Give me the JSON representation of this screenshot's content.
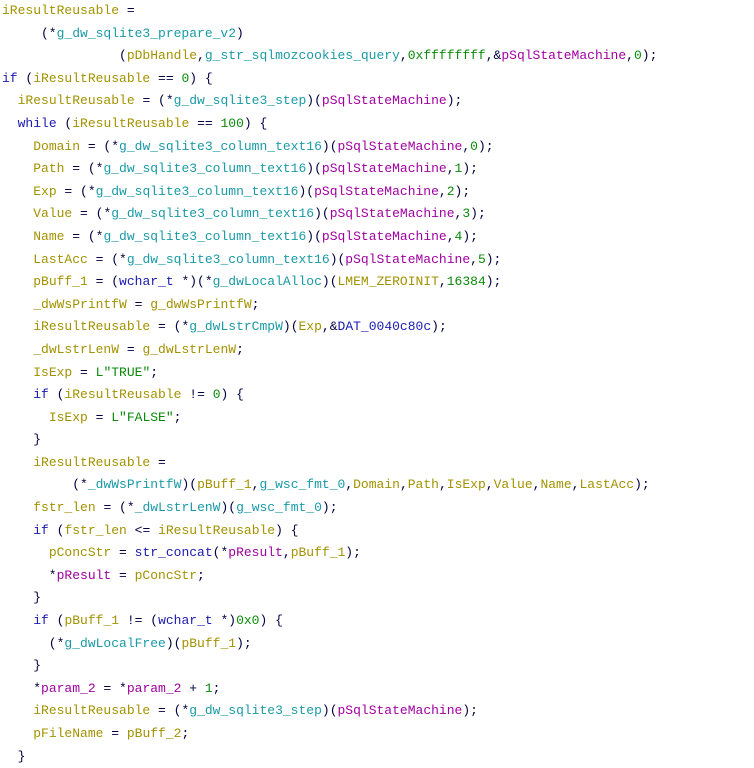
{
  "editor": {
    "kind": "decompiler-listing",
    "colors": {
      "keyword": "#1a1ab0",
      "local_variable": "#a39200",
      "global": "#1a9aa6",
      "parameter": "#a000a0",
      "number": "#0a8a0a",
      "string": "#0a8a0a",
      "punctuation": "#000040",
      "background": "#ffffff"
    },
    "lines": [
      [
        {
          "t": "lv",
          "s": "iResultReusable"
        },
        {
          "t": "op",
          "s": " ="
        }
      ],
      [
        {
          "t": "op",
          "s": "     (*"
        },
        {
          "t": "gl",
          "s": "g_dw_sqlite3_prepare_v2"
        },
        {
          "t": "op",
          "s": ")"
        }
      ],
      [
        {
          "t": "op",
          "s": "               ("
        },
        {
          "t": "lv",
          "s": "pDbHandle"
        },
        {
          "t": "op",
          "s": ","
        },
        {
          "t": "gl",
          "s": "g_str_sqlmozcookies_query"
        },
        {
          "t": "op",
          "s": ","
        },
        {
          "t": "nu",
          "s": "0xffffffff"
        },
        {
          "t": "op",
          "s": ",&"
        },
        {
          "t": "pa",
          "s": "pSqlStateMachine"
        },
        {
          "t": "op",
          "s": ","
        },
        {
          "t": "nu",
          "s": "0"
        },
        {
          "t": "op",
          "s": ");"
        }
      ],
      [
        {
          "t": "kw",
          "s": "if"
        },
        {
          "t": "op",
          "s": " ("
        },
        {
          "t": "lv",
          "s": "iResultReusable"
        },
        {
          "t": "op",
          "s": " == "
        },
        {
          "t": "nu",
          "s": "0"
        },
        {
          "t": "op",
          "s": ") {"
        }
      ],
      [
        {
          "t": "op",
          "s": "  "
        },
        {
          "t": "lv",
          "s": "iResultReusable"
        },
        {
          "t": "op",
          "s": " = (*"
        },
        {
          "t": "gl",
          "s": "g_dw_sqlite3_step"
        },
        {
          "t": "op",
          "s": ")("
        },
        {
          "t": "pa",
          "s": "pSqlStateMachine"
        },
        {
          "t": "op",
          "s": ");"
        }
      ],
      [
        {
          "t": "op",
          "s": "  "
        },
        {
          "t": "kw",
          "s": "while"
        },
        {
          "t": "op",
          "s": " ("
        },
        {
          "t": "lv",
          "s": "iResultReusable"
        },
        {
          "t": "op",
          "s": " == "
        },
        {
          "t": "nu",
          "s": "100"
        },
        {
          "t": "op",
          "s": ") {"
        }
      ],
      [
        {
          "t": "op",
          "s": "    "
        },
        {
          "t": "lv",
          "s": "Domain"
        },
        {
          "t": "op",
          "s": " = (*"
        },
        {
          "t": "gl",
          "s": "g_dw_sqlite3_column_text16"
        },
        {
          "t": "op",
          "s": ")("
        },
        {
          "t": "pa",
          "s": "pSqlStateMachine"
        },
        {
          "t": "op",
          "s": ","
        },
        {
          "t": "nu",
          "s": "0"
        },
        {
          "t": "op",
          "s": ");"
        }
      ],
      [
        {
          "t": "op",
          "s": "    "
        },
        {
          "t": "lv",
          "s": "Path"
        },
        {
          "t": "op",
          "s": " = (*"
        },
        {
          "t": "gl",
          "s": "g_dw_sqlite3_column_text16"
        },
        {
          "t": "op",
          "s": ")("
        },
        {
          "t": "pa",
          "s": "pSqlStateMachine"
        },
        {
          "t": "op",
          "s": ","
        },
        {
          "t": "nu",
          "s": "1"
        },
        {
          "t": "op",
          "s": ");"
        }
      ],
      [
        {
          "t": "op",
          "s": "    "
        },
        {
          "t": "lv",
          "s": "Exp"
        },
        {
          "t": "op",
          "s": " = (*"
        },
        {
          "t": "gl",
          "s": "g_dw_sqlite3_column_text16"
        },
        {
          "t": "op",
          "s": ")("
        },
        {
          "t": "pa",
          "s": "pSqlStateMachine"
        },
        {
          "t": "op",
          "s": ","
        },
        {
          "t": "nu",
          "s": "2"
        },
        {
          "t": "op",
          "s": ");"
        }
      ],
      [
        {
          "t": "op",
          "s": "    "
        },
        {
          "t": "lv",
          "s": "Value"
        },
        {
          "t": "op",
          "s": " = (*"
        },
        {
          "t": "gl",
          "s": "g_dw_sqlite3_column_text16"
        },
        {
          "t": "op",
          "s": ")("
        },
        {
          "t": "pa",
          "s": "pSqlStateMachine"
        },
        {
          "t": "op",
          "s": ","
        },
        {
          "t": "nu",
          "s": "3"
        },
        {
          "t": "op",
          "s": ");"
        }
      ],
      [
        {
          "t": "op",
          "s": "    "
        },
        {
          "t": "lv",
          "s": "Name"
        },
        {
          "t": "op",
          "s": " = (*"
        },
        {
          "t": "gl",
          "s": "g_dw_sqlite3_column_text16"
        },
        {
          "t": "op",
          "s": ")("
        },
        {
          "t": "pa",
          "s": "pSqlStateMachine"
        },
        {
          "t": "op",
          "s": ","
        },
        {
          "t": "nu",
          "s": "4"
        },
        {
          "t": "op",
          "s": ");"
        }
      ],
      [
        {
          "t": "op",
          "s": "    "
        },
        {
          "t": "lv",
          "s": "LastAcc"
        },
        {
          "t": "op",
          "s": " = (*"
        },
        {
          "t": "gl",
          "s": "g_dw_sqlite3_column_text16"
        },
        {
          "t": "op",
          "s": ")("
        },
        {
          "t": "pa",
          "s": "pSqlStateMachine"
        },
        {
          "t": "op",
          "s": ","
        },
        {
          "t": "nu",
          "s": "5"
        },
        {
          "t": "op",
          "s": ");"
        }
      ],
      [
        {
          "t": "op",
          "s": "    "
        },
        {
          "t": "lv",
          "s": "pBuff_1"
        },
        {
          "t": "op",
          "s": " = ("
        },
        {
          "t": "ty",
          "s": "wchar_t"
        },
        {
          "t": "op",
          "s": " *)(*"
        },
        {
          "t": "gl",
          "s": "g_dwLocalAlloc"
        },
        {
          "t": "op",
          "s": ")("
        },
        {
          "t": "lv",
          "s": "LMEM_ZEROINIT"
        },
        {
          "t": "op",
          "s": ","
        },
        {
          "t": "nu",
          "s": "16384"
        },
        {
          "t": "op",
          "s": ");"
        }
      ],
      [
        {
          "t": "op",
          "s": "    "
        },
        {
          "t": "lv",
          "s": "_dwWsPrintfW"
        },
        {
          "t": "op",
          "s": " = "
        },
        {
          "t": "lv",
          "s": "g_dwWsPrintfW"
        },
        {
          "t": "op",
          "s": ";"
        }
      ],
      [
        {
          "t": "op",
          "s": "    "
        },
        {
          "t": "lv",
          "s": "iResultReusable"
        },
        {
          "t": "op",
          "s": " = (*"
        },
        {
          "t": "gl",
          "s": "g_dwLstrCmpW"
        },
        {
          "t": "op",
          "s": ")("
        },
        {
          "t": "lv",
          "s": "Exp"
        },
        {
          "t": "op",
          "s": ",&"
        },
        {
          "t": "da",
          "s": "DAT_0040c80c"
        },
        {
          "t": "op",
          "s": ");"
        }
      ],
      [
        {
          "t": "op",
          "s": "    "
        },
        {
          "t": "lv",
          "s": "_dwLstrLenW"
        },
        {
          "t": "op",
          "s": " = "
        },
        {
          "t": "lv",
          "s": "g_dwLstrLenW"
        },
        {
          "t": "op",
          "s": ";"
        }
      ],
      [
        {
          "t": "op",
          "s": "    "
        },
        {
          "t": "lv",
          "s": "IsExp"
        },
        {
          "t": "op",
          "s": " = "
        },
        {
          "t": "st",
          "s": "L\"TRUE\""
        },
        {
          "t": "op",
          "s": ";"
        }
      ],
      [
        {
          "t": "op",
          "s": "    "
        },
        {
          "t": "kw",
          "s": "if"
        },
        {
          "t": "op",
          "s": " ("
        },
        {
          "t": "lv",
          "s": "iResultReusable"
        },
        {
          "t": "op",
          "s": " != "
        },
        {
          "t": "nu",
          "s": "0"
        },
        {
          "t": "op",
          "s": ") {"
        }
      ],
      [
        {
          "t": "op",
          "s": "      "
        },
        {
          "t": "lv",
          "s": "IsExp"
        },
        {
          "t": "op",
          "s": " = "
        },
        {
          "t": "st",
          "s": "L\"FALSE\""
        },
        {
          "t": "op",
          "s": ";"
        }
      ],
      [
        {
          "t": "op",
          "s": "    }"
        }
      ],
      [
        {
          "t": "op",
          "s": "    "
        },
        {
          "t": "lv",
          "s": "iResultReusable"
        },
        {
          "t": "op",
          "s": " ="
        }
      ],
      [
        {
          "t": "op",
          "s": "         (*"
        },
        {
          "t": "gl",
          "s": "_dwWsPrintfW"
        },
        {
          "t": "op",
          "s": ")("
        },
        {
          "t": "lv",
          "s": "pBuff_1"
        },
        {
          "t": "op",
          "s": ","
        },
        {
          "t": "gl",
          "s": "g_wsc_fmt_0"
        },
        {
          "t": "op",
          "s": ","
        },
        {
          "t": "lv",
          "s": "Domain"
        },
        {
          "t": "op",
          "s": ","
        },
        {
          "t": "lv",
          "s": "Path"
        },
        {
          "t": "op",
          "s": ","
        },
        {
          "t": "lv",
          "s": "IsExp"
        },
        {
          "t": "op",
          "s": ","
        },
        {
          "t": "lv",
          "s": "Value"
        },
        {
          "t": "op",
          "s": ","
        },
        {
          "t": "lv",
          "s": "Name"
        },
        {
          "t": "op",
          "s": ","
        },
        {
          "t": "lv",
          "s": "LastAcc"
        },
        {
          "t": "op",
          "s": ");"
        }
      ],
      [
        {
          "t": "op",
          "s": "    "
        },
        {
          "t": "lv",
          "s": "fstr_len"
        },
        {
          "t": "op",
          "s": " = (*"
        },
        {
          "t": "gl",
          "s": "_dwLstrLenW"
        },
        {
          "t": "op",
          "s": ")("
        },
        {
          "t": "gl",
          "s": "g_wsc_fmt_0"
        },
        {
          "t": "op",
          "s": ");"
        }
      ],
      [
        {
          "t": "op",
          "s": "    "
        },
        {
          "t": "kw",
          "s": "if"
        },
        {
          "t": "op",
          "s": " ("
        },
        {
          "t": "lv",
          "s": "fstr_len"
        },
        {
          "t": "op",
          "s": " <= "
        },
        {
          "t": "lv",
          "s": "iResultReusable"
        },
        {
          "t": "op",
          "s": ") {"
        }
      ],
      [
        {
          "t": "op",
          "s": "      "
        },
        {
          "t": "lv",
          "s": "pConcStr"
        },
        {
          "t": "op",
          "s": " = "
        },
        {
          "t": "fn",
          "s": "str_concat"
        },
        {
          "t": "op",
          "s": "(*"
        },
        {
          "t": "pa",
          "s": "pResult"
        },
        {
          "t": "op",
          "s": ","
        },
        {
          "t": "lv",
          "s": "pBuff_1"
        },
        {
          "t": "op",
          "s": ");"
        }
      ],
      [
        {
          "t": "op",
          "s": "      *"
        },
        {
          "t": "pa",
          "s": "pResult"
        },
        {
          "t": "op",
          "s": " = "
        },
        {
          "t": "lv",
          "s": "pConcStr"
        },
        {
          "t": "op",
          "s": ";"
        }
      ],
      [
        {
          "t": "op",
          "s": "    }"
        }
      ],
      [
        {
          "t": "op",
          "s": "    "
        },
        {
          "t": "kw",
          "s": "if"
        },
        {
          "t": "op",
          "s": " ("
        },
        {
          "t": "lv",
          "s": "pBuff_1"
        },
        {
          "t": "op",
          "s": " != ("
        },
        {
          "t": "ty",
          "s": "wchar_t"
        },
        {
          "t": "op",
          "s": " *)"
        },
        {
          "t": "nu",
          "s": "0x0"
        },
        {
          "t": "op",
          "s": ") {"
        }
      ],
      [
        {
          "t": "op",
          "s": "      (*"
        },
        {
          "t": "gl",
          "s": "g_dwLocalFree"
        },
        {
          "t": "op",
          "s": ")("
        },
        {
          "t": "lv",
          "s": "pBuff_1"
        },
        {
          "t": "op",
          "s": ");"
        }
      ],
      [
        {
          "t": "op",
          "s": "    }"
        }
      ],
      [
        {
          "t": "op",
          "s": "    *"
        },
        {
          "t": "pa",
          "s": "param_2"
        },
        {
          "t": "op",
          "s": " = *"
        },
        {
          "t": "pa",
          "s": "param_2"
        },
        {
          "t": "op",
          "s": " + "
        },
        {
          "t": "nu",
          "s": "1"
        },
        {
          "t": "op",
          "s": ";"
        }
      ],
      [
        {
          "t": "op",
          "s": "    "
        },
        {
          "t": "lv",
          "s": "iResultReusable"
        },
        {
          "t": "op",
          "s": " = (*"
        },
        {
          "t": "gl",
          "s": "g_dw_sqlite3_step"
        },
        {
          "t": "op",
          "s": ")("
        },
        {
          "t": "pa",
          "s": "pSqlStateMachine"
        },
        {
          "t": "op",
          "s": ");"
        }
      ],
      [
        {
          "t": "op",
          "s": "    "
        },
        {
          "t": "lv",
          "s": "pFileName"
        },
        {
          "t": "op",
          "s": " = "
        },
        {
          "t": "lv",
          "s": "pBuff_2"
        },
        {
          "t": "op",
          "s": ";"
        }
      ],
      [
        {
          "t": "op",
          "s": "  }"
        }
      ]
    ]
  }
}
